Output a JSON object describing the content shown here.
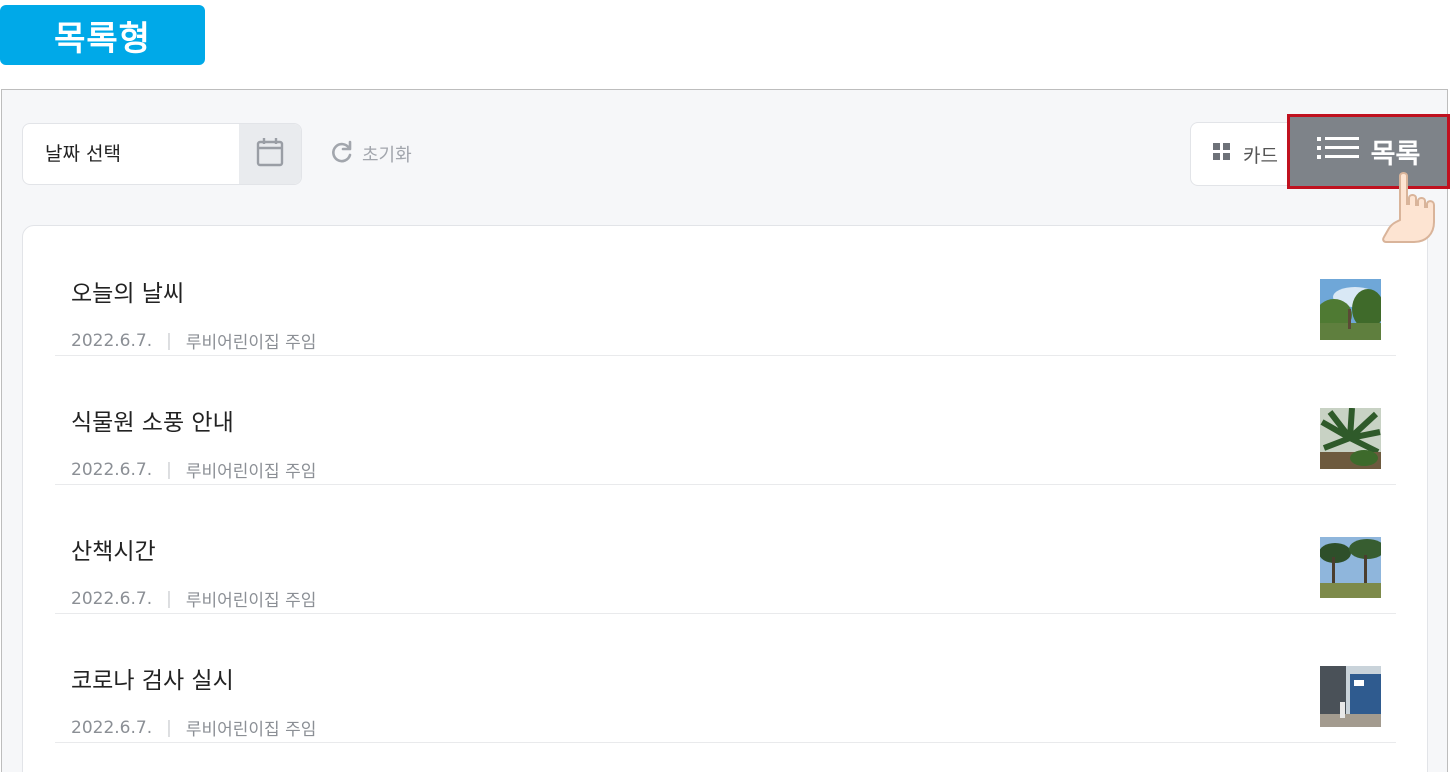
{
  "header": {
    "title": "목록형"
  },
  "toolbar": {
    "date_select_label": "날짜 선택",
    "calendar_icon": "calendar-icon",
    "reset_label": "초기화",
    "reset_icon": "refresh-icon",
    "view_card_label": "카드",
    "view_list_label": "목록",
    "grid_icon": "grid-icon",
    "list_icon": "list-icon",
    "selected_view": "목록"
  },
  "colors": {
    "badge": "#00a9e8",
    "selected_view_bg": "#7e8389",
    "highlight_border": "#c0111f"
  },
  "posts": [
    {
      "title": "오늘의 날씨",
      "date": "2022.6.7.",
      "author": "루비어린이집 주임"
    },
    {
      "title": "식물원 소풍 안내",
      "date": "2022.6.7.",
      "author": "루비어린이집 주임"
    },
    {
      "title": "산책시간",
      "date": "2022.6.7.",
      "author": "루비어린이집 주임"
    },
    {
      "title": "코로나 검사 실시",
      "date": "2022.6.7.",
      "author": "루비어린이집 주임"
    }
  ]
}
